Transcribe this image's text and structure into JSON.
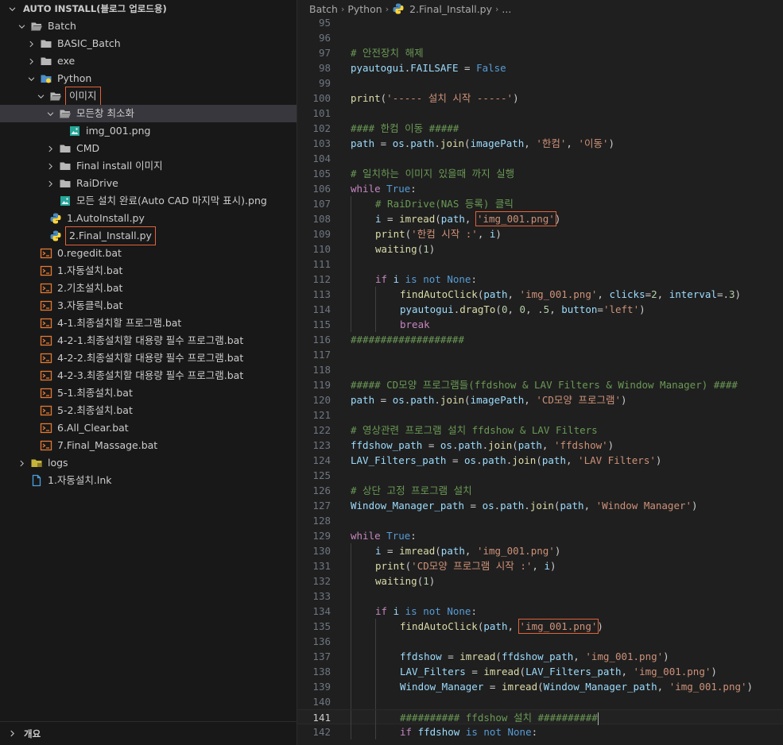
{
  "explorer": {
    "title": "AUTO INSTALL(블로그 업로드용)",
    "outline_label": "개요",
    "items": [
      {
        "label": "Batch",
        "depth": 0,
        "type": "folder",
        "open": true
      },
      {
        "label": "BASIC_Batch",
        "depth": 1,
        "type": "folder",
        "open": false
      },
      {
        "label": "exe",
        "depth": 1,
        "type": "folder",
        "open": false
      },
      {
        "label": "Python",
        "depth": 1,
        "type": "folder-python",
        "open": true
      },
      {
        "label": "이미지",
        "depth": 2,
        "type": "folder",
        "open": true,
        "boxed": true
      },
      {
        "label": "모든창 최소화",
        "depth": 3,
        "type": "folder",
        "open": true,
        "selected": true
      },
      {
        "label": "img_001.png",
        "depth": 4,
        "type": "image"
      },
      {
        "label": "CMD",
        "depth": 3,
        "type": "folder",
        "open": false
      },
      {
        "label": "Final install 이미지",
        "depth": 3,
        "type": "folder",
        "open": false
      },
      {
        "label": "RaiDrive",
        "depth": 3,
        "type": "folder",
        "open": false
      },
      {
        "label": "모든 설치 완료(Auto CAD 마지막 표시).png",
        "depth": 3,
        "type": "image"
      },
      {
        "label": "1.AutoInstall.py",
        "depth": 2,
        "type": "python"
      },
      {
        "label": "2.Final_Install.py",
        "depth": 2,
        "type": "python",
        "boxed": true
      },
      {
        "label": "0.regedit.bat",
        "depth": 1,
        "type": "bat"
      },
      {
        "label": "1.자동설치.bat",
        "depth": 1,
        "type": "bat"
      },
      {
        "label": "2.기초설치.bat",
        "depth": 1,
        "type": "bat"
      },
      {
        "label": "3.자동클릭.bat",
        "depth": 1,
        "type": "bat"
      },
      {
        "label": "4-1.최종설치할 프로그램.bat",
        "depth": 1,
        "type": "bat"
      },
      {
        "label": "4-2-1.최종설치할 대용량 필수 프로그램.bat",
        "depth": 1,
        "type": "bat"
      },
      {
        "label": "4-2-2.최종설치할 대용량 필수 프로그램.bat",
        "depth": 1,
        "type": "bat"
      },
      {
        "label": "4-2-3.최종설치할 대용량 필수 프로그램.bat",
        "depth": 1,
        "type": "bat"
      },
      {
        "label": "5-1.최종설치.bat",
        "depth": 1,
        "type": "bat"
      },
      {
        "label": "5-2.최종설치.bat",
        "depth": 1,
        "type": "bat"
      },
      {
        "label": "6.All_Clear.bat",
        "depth": 1,
        "type": "bat"
      },
      {
        "label": "7.Final_Massage.bat",
        "depth": 1,
        "type": "bat"
      },
      {
        "label": "logs",
        "depth": 0,
        "type": "folder-logs",
        "open": false
      },
      {
        "label": "1.자동설치.lnk",
        "depth": 0,
        "type": "link"
      }
    ]
  },
  "breadcrumb": [
    "Batch",
    "Python",
    "2.Final_Install.py",
    "..."
  ],
  "code": {
    "current_line": 141,
    "lines": [
      {
        "n": 95,
        "t": []
      },
      {
        "n": 96,
        "t": []
      },
      {
        "n": 97,
        "t": [
          [
            "cm",
            "# 안전장치 해제"
          ]
        ]
      },
      {
        "n": 98,
        "t": [
          [
            "var",
            "pyautogui"
          ],
          [
            "pl",
            "."
          ],
          [
            "var",
            "FAILSAFE"
          ],
          [
            "pl",
            " = "
          ],
          [
            "kw",
            "False"
          ]
        ]
      },
      {
        "n": 99,
        "t": []
      },
      {
        "n": 100,
        "t": [
          [
            "fn",
            "print"
          ],
          [
            "pl",
            "("
          ],
          [
            "str",
            "'----- 설치 시작 -----'"
          ],
          [
            "pl",
            ")"
          ]
        ]
      },
      {
        "n": 101,
        "t": []
      },
      {
        "n": 102,
        "t": [
          [
            "cm",
            "#### 한컴 이동 #####"
          ]
        ]
      },
      {
        "n": 103,
        "t": [
          [
            "var",
            "path"
          ],
          [
            "pl",
            " = "
          ],
          [
            "var",
            "os"
          ],
          [
            "pl",
            "."
          ],
          [
            "var",
            "path"
          ],
          [
            "pl",
            "."
          ],
          [
            "fn",
            "join"
          ],
          [
            "pl",
            "("
          ],
          [
            "var",
            "imagePath"
          ],
          [
            "pl",
            ", "
          ],
          [
            "str",
            "'한컴'"
          ],
          [
            "pl",
            ", "
          ],
          [
            "str",
            "'이동'"
          ],
          [
            "pl",
            ")"
          ]
        ]
      },
      {
        "n": 104,
        "t": []
      },
      {
        "n": 105,
        "t": [
          [
            "cm",
            "# 일치하는 이미지 있을때 까지 실행"
          ]
        ]
      },
      {
        "n": 106,
        "t": [
          [
            "kw2",
            "while"
          ],
          [
            "pl",
            " "
          ],
          [
            "kw",
            "True"
          ],
          [
            "pl",
            ":"
          ]
        ]
      },
      {
        "n": 107,
        "ind": 1,
        "t": [
          [
            "cm",
            "# RaiDrive(NAS 등록) 클릭"
          ]
        ]
      },
      {
        "n": 108,
        "ind": 1,
        "t": [
          [
            "var",
            "i"
          ],
          [
            "pl",
            " = "
          ],
          [
            "fn",
            "imread"
          ],
          [
            "pl",
            "("
          ],
          [
            "var",
            "path"
          ],
          [
            "pl",
            ", "
          ],
          [
            "str",
            "'img_001.png'",
            "hl"
          ],
          [
            "pl",
            ")"
          ]
        ]
      },
      {
        "n": 109,
        "ind": 1,
        "t": [
          [
            "fn",
            "print"
          ],
          [
            "pl",
            "("
          ],
          [
            "str",
            "'한컴 시작 :'"
          ],
          [
            "pl",
            ", "
          ],
          [
            "var",
            "i"
          ],
          [
            "pl",
            ")"
          ]
        ]
      },
      {
        "n": 110,
        "ind": 1,
        "t": [
          [
            "fn",
            "waiting"
          ],
          [
            "pl",
            "("
          ],
          [
            "num",
            "1"
          ],
          [
            "pl",
            ")"
          ]
        ]
      },
      {
        "n": 111,
        "ind": 1,
        "t": []
      },
      {
        "n": 112,
        "ind": 1,
        "t": [
          [
            "kw2",
            "if"
          ],
          [
            "pl",
            " "
          ],
          [
            "var",
            "i"
          ],
          [
            "pl",
            " "
          ],
          [
            "kw",
            "is not"
          ],
          [
            "pl",
            " "
          ],
          [
            "kw",
            "None"
          ],
          [
            "pl",
            ":"
          ]
        ]
      },
      {
        "n": 113,
        "ind": 2,
        "t": [
          [
            "fn",
            "findAutoClick"
          ],
          [
            "pl",
            "("
          ],
          [
            "var",
            "path"
          ],
          [
            "pl",
            ", "
          ],
          [
            "str",
            "'img_001.png'"
          ],
          [
            "pl",
            ", "
          ],
          [
            "var",
            "clicks"
          ],
          [
            "pl",
            "="
          ],
          [
            "num",
            "2"
          ],
          [
            "pl",
            ", "
          ],
          [
            "var",
            "interval"
          ],
          [
            "pl",
            "=."
          ],
          [
            "num",
            "3"
          ],
          [
            "pl",
            ")"
          ]
        ]
      },
      {
        "n": 114,
        "ind": 2,
        "t": [
          [
            "var",
            "pyautogui"
          ],
          [
            "pl",
            "."
          ],
          [
            "fn",
            "dragTo"
          ],
          [
            "pl",
            "("
          ],
          [
            "num",
            "0"
          ],
          [
            "pl",
            ", "
          ],
          [
            "num",
            "0"
          ],
          [
            "pl",
            ", ."
          ],
          [
            "num",
            "5"
          ],
          [
            "pl",
            ", "
          ],
          [
            "var",
            "button"
          ],
          [
            "pl",
            "="
          ],
          [
            "str",
            "'left'"
          ],
          [
            "pl",
            ")"
          ]
        ]
      },
      {
        "n": 115,
        "ind": 2,
        "t": [
          [
            "kw2",
            "break"
          ]
        ]
      },
      {
        "n": 116,
        "t": [
          [
            "cm",
            "###################"
          ]
        ]
      },
      {
        "n": 117,
        "t": []
      },
      {
        "n": 118,
        "t": []
      },
      {
        "n": 119,
        "t": [
          [
            "cm",
            "##### CD모양 프로그램들(ffdshow & LAV Filters & Window Manager) ####"
          ]
        ]
      },
      {
        "n": 120,
        "t": [
          [
            "var",
            "path"
          ],
          [
            "pl",
            " = "
          ],
          [
            "var",
            "os"
          ],
          [
            "pl",
            "."
          ],
          [
            "var",
            "path"
          ],
          [
            "pl",
            "."
          ],
          [
            "fn",
            "join"
          ],
          [
            "pl",
            "("
          ],
          [
            "var",
            "imagePath"
          ],
          [
            "pl",
            ", "
          ],
          [
            "str",
            "'CD모양 프로그램'"
          ],
          [
            "pl",
            ")"
          ]
        ]
      },
      {
        "n": 121,
        "t": []
      },
      {
        "n": 122,
        "t": [
          [
            "cm",
            "# 영상관련 프로그램 설치 ffdshow & LAV Filters"
          ]
        ]
      },
      {
        "n": 123,
        "t": [
          [
            "var",
            "ffdshow_path"
          ],
          [
            "pl",
            " = "
          ],
          [
            "var",
            "os"
          ],
          [
            "pl",
            "."
          ],
          [
            "var",
            "path"
          ],
          [
            "pl",
            "."
          ],
          [
            "fn",
            "join"
          ],
          [
            "pl",
            "("
          ],
          [
            "var",
            "path"
          ],
          [
            "pl",
            ", "
          ],
          [
            "str",
            "'ffdshow'"
          ],
          [
            "pl",
            ")"
          ]
        ]
      },
      {
        "n": 124,
        "t": [
          [
            "var",
            "LAV_Filters_path"
          ],
          [
            "pl",
            " = "
          ],
          [
            "var",
            "os"
          ],
          [
            "pl",
            "."
          ],
          [
            "var",
            "path"
          ],
          [
            "pl",
            "."
          ],
          [
            "fn",
            "join"
          ],
          [
            "pl",
            "("
          ],
          [
            "var",
            "path"
          ],
          [
            "pl",
            ", "
          ],
          [
            "str",
            "'LAV Filters'"
          ],
          [
            "pl",
            ")"
          ]
        ]
      },
      {
        "n": 125,
        "t": []
      },
      {
        "n": 126,
        "t": [
          [
            "cm",
            "# 상단 고정 프로그램 설치"
          ]
        ]
      },
      {
        "n": 127,
        "t": [
          [
            "var",
            "Window_Manager_path"
          ],
          [
            "pl",
            " = "
          ],
          [
            "var",
            "os"
          ],
          [
            "pl",
            "."
          ],
          [
            "var",
            "path"
          ],
          [
            "pl",
            "."
          ],
          [
            "fn",
            "join"
          ],
          [
            "pl",
            "("
          ],
          [
            "var",
            "path"
          ],
          [
            "pl",
            ", "
          ],
          [
            "str",
            "'Window Manager'"
          ],
          [
            "pl",
            ")"
          ]
        ]
      },
      {
        "n": 128,
        "t": []
      },
      {
        "n": 129,
        "t": [
          [
            "kw2",
            "while"
          ],
          [
            "pl",
            " "
          ],
          [
            "kw",
            "True"
          ],
          [
            "pl",
            ":"
          ]
        ]
      },
      {
        "n": 130,
        "ind": 1,
        "t": [
          [
            "var",
            "i"
          ],
          [
            "pl",
            " = "
          ],
          [
            "fn",
            "imread"
          ],
          [
            "pl",
            "("
          ],
          [
            "var",
            "path"
          ],
          [
            "pl",
            ", "
          ],
          [
            "str",
            "'img_001.png'"
          ],
          [
            "pl",
            ")"
          ]
        ]
      },
      {
        "n": 131,
        "ind": 1,
        "t": [
          [
            "fn",
            "print"
          ],
          [
            "pl",
            "("
          ],
          [
            "str",
            "'CD모양 프로그램 시작 :'"
          ],
          [
            "pl",
            ", "
          ],
          [
            "var",
            "i"
          ],
          [
            "pl",
            ")"
          ]
        ]
      },
      {
        "n": 132,
        "ind": 1,
        "t": [
          [
            "fn",
            "waiting"
          ],
          [
            "pl",
            "("
          ],
          [
            "num",
            "1"
          ],
          [
            "pl",
            ")"
          ]
        ]
      },
      {
        "n": 133,
        "ind": 1,
        "t": []
      },
      {
        "n": 134,
        "ind": 1,
        "t": [
          [
            "kw2",
            "if"
          ],
          [
            "pl",
            " "
          ],
          [
            "var",
            "i"
          ],
          [
            "pl",
            " "
          ],
          [
            "kw",
            "is not"
          ],
          [
            "pl",
            " "
          ],
          [
            "kw",
            "None"
          ],
          [
            "pl",
            ":"
          ]
        ]
      },
      {
        "n": 135,
        "ind": 2,
        "t": [
          [
            "fn",
            "findAutoClick"
          ],
          [
            "pl",
            "("
          ],
          [
            "var",
            "path"
          ],
          [
            "pl",
            ", "
          ],
          [
            "str",
            "'img_001.png'",
            "hl"
          ],
          [
            "pl",
            ")"
          ]
        ]
      },
      {
        "n": 136,
        "ind": 2,
        "t": []
      },
      {
        "n": 137,
        "ind": 2,
        "t": [
          [
            "var",
            "ffdshow"
          ],
          [
            "pl",
            " = "
          ],
          [
            "fn",
            "imread"
          ],
          [
            "pl",
            "("
          ],
          [
            "var",
            "ffdshow_path"
          ],
          [
            "pl",
            ", "
          ],
          [
            "str",
            "'img_001.png'"
          ],
          [
            "pl",
            ")"
          ]
        ]
      },
      {
        "n": 138,
        "ind": 2,
        "t": [
          [
            "var",
            "LAV_Filters"
          ],
          [
            "pl",
            " = "
          ],
          [
            "fn",
            "imread"
          ],
          [
            "pl",
            "("
          ],
          [
            "var",
            "LAV_Filters_path"
          ],
          [
            "pl",
            ", "
          ],
          [
            "str",
            "'img_001.png'"
          ],
          [
            "pl",
            ")"
          ]
        ]
      },
      {
        "n": 139,
        "ind": 2,
        "t": [
          [
            "var",
            "Window_Manager"
          ],
          [
            "pl",
            " = "
          ],
          [
            "fn",
            "imread"
          ],
          [
            "pl",
            "("
          ],
          [
            "var",
            "Window_Manager_path"
          ],
          [
            "pl",
            ", "
          ],
          [
            "str",
            "'img_001.png'"
          ],
          [
            "pl",
            ")"
          ]
        ]
      },
      {
        "n": 140,
        "ind": 2,
        "t": []
      },
      {
        "n": 141,
        "ind": 2,
        "t": [
          [
            "cm",
            "########## ffdshow 설치 ##########"
          ]
        ],
        "cursor": true
      },
      {
        "n": 142,
        "ind": 2,
        "t": [
          [
            "kw2",
            "if"
          ],
          [
            "pl",
            " "
          ],
          [
            "var",
            "ffdshow"
          ],
          [
            "pl",
            " "
          ],
          [
            "kw",
            "is not"
          ],
          [
            "pl",
            " "
          ],
          [
            "kw",
            "None"
          ],
          [
            "pl",
            ":"
          ]
        ]
      }
    ]
  }
}
